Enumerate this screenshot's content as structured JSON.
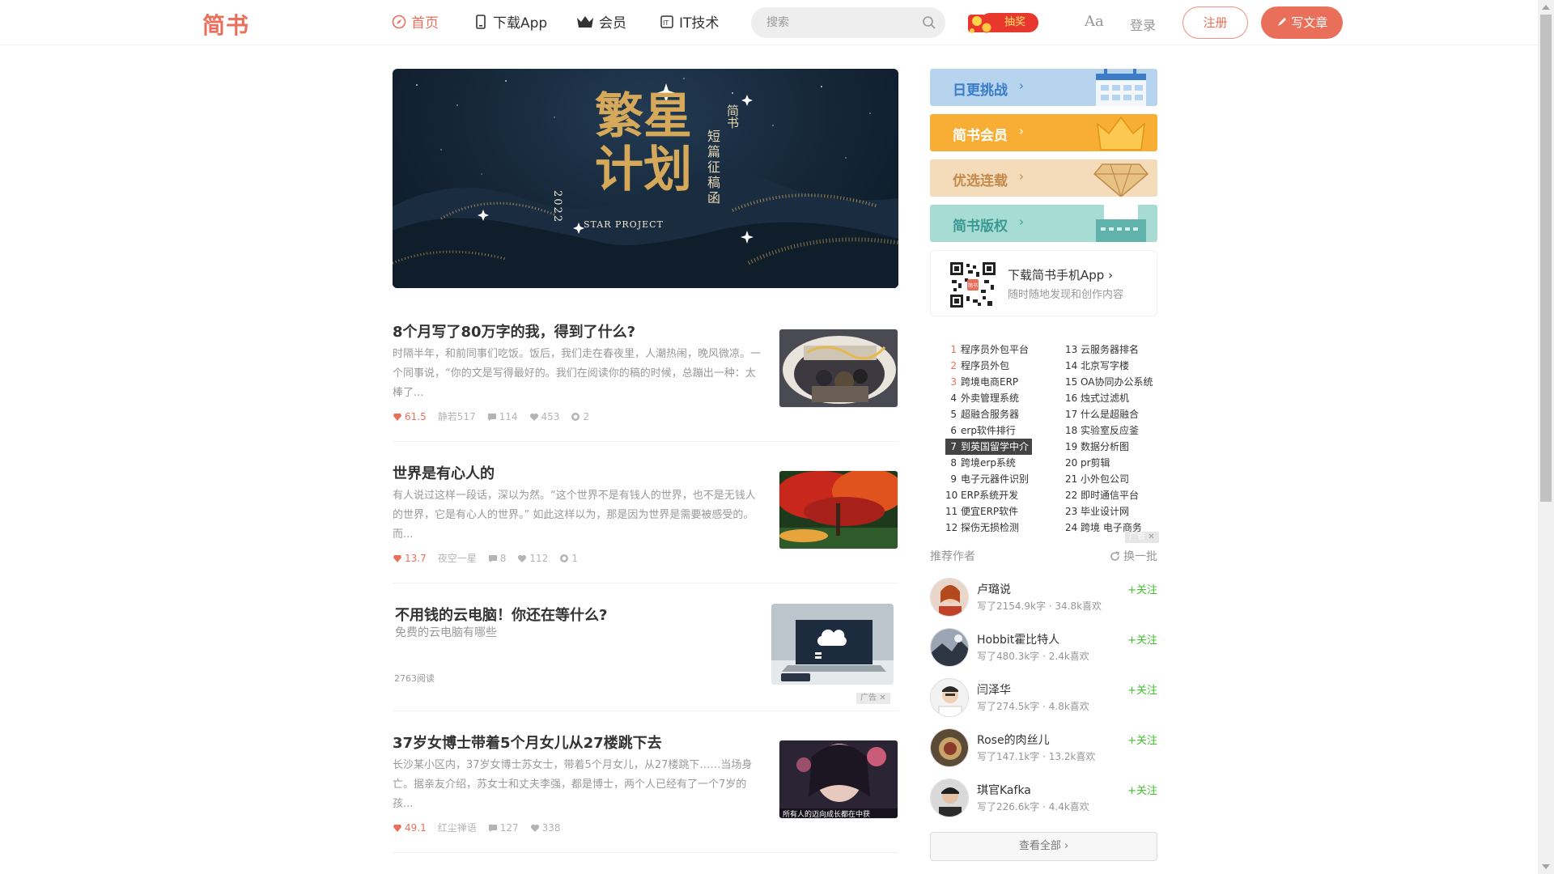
{
  "header": {
    "logo": "简书",
    "nav": [
      {
        "label": "首页",
        "icon": "compass-icon",
        "active": true
      },
      {
        "label": "下载App",
        "icon": "phone-icon"
      },
      {
        "label": "会员",
        "icon": "crown-icon"
      },
      {
        "label": "IT技术",
        "icon": "it-icon"
      }
    ],
    "search_placeholder": "搜索",
    "lottery_label": "抽奖",
    "font_toggle": "Aa",
    "login": "登录",
    "register": "注册",
    "write": "写文章",
    "accent": "#ea6f5a"
  },
  "banner": {
    "title_art": "繁星计划",
    "vertical_brand": "简书",
    "vertical_caption": "短篇征稿函",
    "year": "2022",
    "star_project": "STAR PROJECT"
  },
  "articles": [
    {
      "title": "8个月写了80万字的我，得到了什么?",
      "abstract": "时隔半年，和前同事们吃饭。饭后，我们走在春夜里，人潮热闹，晚风微凉。一个同事说，“你的文是写得最好的。我们在阅读你的稿的时候，总蹦出一种：太棒了...",
      "jsd": "61.5",
      "author": "静若517",
      "comments": "114",
      "likes": "453",
      "rewards": "2"
    },
    {
      "title": "世界是有心人的",
      "abstract": "有人说过这样一段话，深以为然。“这个世界不是有钱人的世界，也不是无钱人的世界，它是有心人的世界。” 如此这样以为，那是因为世界是需要被感受的。而...",
      "jsd": "13.7",
      "author": "夜空一星",
      "comments": "8",
      "likes": "112",
      "rewards": "1"
    },
    {
      "title": "不用钱的云电脑！你还在等什么?",
      "subtitle": "免费的云电脑有哪些",
      "reads": "2763阅读",
      "ad_label": "广告"
    },
    {
      "title": "37岁女博士带着5个月女儿从27楼跳下去",
      "abstract": "长沙某小区内，37岁女博士苏女士，带着5个月女儿，从27楼跳下……当场身亡。据亲友介绍，苏女士和丈夫李强，都是博士，两个人已经有了一个7岁的孩...",
      "jsd": "49.1",
      "author": "红尘禅语",
      "comments": "127",
      "likes": "338",
      "thumb_caption": "所有人的迈向成长都在中获"
    }
  ],
  "sidebar": {
    "banners": [
      {
        "label": "日更挑战",
        "color": "#3c7cc6",
        "bg": "#b7d4ef"
      },
      {
        "label": "简书会员",
        "color": "#ffffff",
        "bg": "#f8ae35"
      },
      {
        "label": "优选连载",
        "color": "#c38a4e",
        "bg": "#f4dcba"
      },
      {
        "label": "简书版权",
        "color": "#3a9a93",
        "bg": "#a7dcd4"
      }
    ],
    "download": {
      "title": "下载简书手机App",
      "sub": "随时随地发现和创作内容",
      "qr_center": "简书"
    },
    "hot_left": [
      {
        "n": "1",
        "t": "程序员外包平台"
      },
      {
        "n": "2",
        "t": "程序员外包"
      },
      {
        "n": "3",
        "t": "跨境电商ERP"
      },
      {
        "n": "4",
        "t": "外卖管理系统"
      },
      {
        "n": "5",
        "t": "超融合服务器"
      },
      {
        "n": "6",
        "t": "erp软件排行"
      },
      {
        "n": "7",
        "t": "到英国留学中介"
      },
      {
        "n": "8",
        "t": "跨境erp系统"
      },
      {
        "n": "9",
        "t": "电子元器件识别"
      },
      {
        "n": "10",
        "t": "ERP系统开发"
      },
      {
        "n": "11",
        "t": "便宜ERP软件"
      },
      {
        "n": "12",
        "t": "探伤无损检测"
      }
    ],
    "hot_right": [
      {
        "n": "13",
        "t": "云服务器排名"
      },
      {
        "n": "14",
        "t": "北京写字楼"
      },
      {
        "n": "15",
        "t": "OA协同办公系统"
      },
      {
        "n": "16",
        "t": "烛式过滤机"
      },
      {
        "n": "17",
        "t": "什么是超融合"
      },
      {
        "n": "18",
        "t": "实验室反应釜"
      },
      {
        "n": "19",
        "t": "数据分析图"
      },
      {
        "n": "20",
        "t": "pr剪辑"
      },
      {
        "n": "21",
        "t": "小外包公司"
      },
      {
        "n": "22",
        "t": "即时通信平台"
      },
      {
        "n": "23",
        "t": "毕业设计网"
      },
      {
        "n": "24",
        "t": "跨境 电子商务"
      }
    ],
    "hot_ad_label": "广告",
    "rec_title": "推荐作者",
    "refresh": "换一批",
    "authors": [
      {
        "name": "卢璐说",
        "stat": "写了2154.9k字 · 34.8k喜欢",
        "follow": "+关注"
      },
      {
        "name": "Hobbit霍比特人",
        "stat": "写了480.3k字 · 2.4k喜欢",
        "follow": "+关注"
      },
      {
        "name": "闫泽华",
        "stat": "写了274.5k字 · 4.8k喜欢",
        "follow": "+关注"
      },
      {
        "name": "Rose的肉丝儿",
        "stat": "写了147.1k字 · 13.2k喜欢",
        "follow": "+关注"
      },
      {
        "name": "琪官Kafka",
        "stat": "写了226.6k字 · 4.4k喜欢",
        "follow": "+关注"
      }
    ],
    "view_all": "查看全部 ›"
  }
}
